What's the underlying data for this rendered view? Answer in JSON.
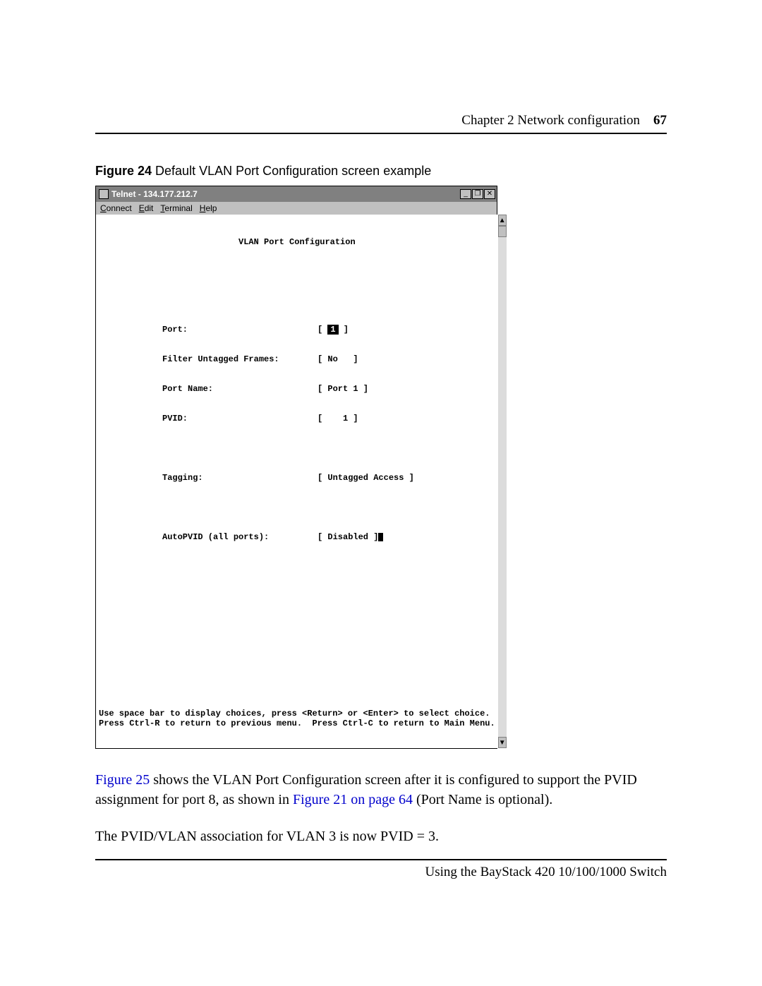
{
  "header": {
    "chapter_text": "Chapter 2  Network configuration",
    "page_number": "67"
  },
  "figure_caption": {
    "label": "Figure 24",
    "text": "   Default VLAN Port Configuration screen example"
  },
  "telnet": {
    "title": "Telnet - 134.177.212.7",
    "menus": {
      "connect": "Connect",
      "edit": "Edit",
      "terminal": "Terminal",
      "help": "Help"
    },
    "win_buttons": {
      "min": "_",
      "max": "❐",
      "close": "✕"
    },
    "scroll": {
      "up": "▲",
      "down": "▼"
    },
    "screen_title": "VLAN Port Configuration",
    "fields": {
      "port_label": "Port:",
      "port_value": "1",
      "filter_label": "Filter Untagged Frames:",
      "filter_value": "[ No   ]",
      "portname_label": "Port Name:",
      "portname_value": "[ Port 1 ]",
      "pvid_label": "PVID:",
      "pvid_value": "[    1 ]",
      "tagging_label": "Tagging:",
      "tagging_value": "[ Untagged Access ]",
      "autopvid_label": "AutoPVID (all ports):",
      "autopvid_value": "[ Disabled ]"
    },
    "help1": "Use space bar to display choices, press <Return> or <Enter> to select choice.",
    "help2": "Press Ctrl-R to return to previous menu.  Press Ctrl-C to return to Main Menu."
  },
  "body": {
    "p1a": "Figure 25",
    "p1b": " shows the VLAN Port Configuration screen after it is configured to support the PVID assignment for port 8, as shown in ",
    "p1c": "Figure 21 on page 64",
    "p1d": " (Port Name is optional).",
    "p2": "The PVID/VLAN association for VLAN 3 is now PVID = 3."
  },
  "footer": {
    "text": "Using the BayStack 420 10/100/1000 Switch"
  }
}
